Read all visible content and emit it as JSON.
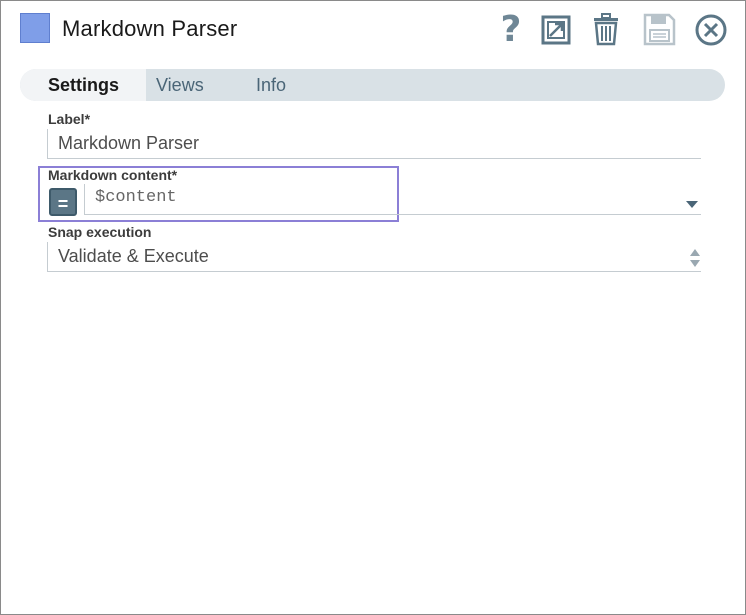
{
  "header": {
    "title": "Markdown Parser",
    "swatch_color": "#7f9ee8",
    "icons": [
      "help-icon",
      "export-icon",
      "delete-icon",
      "save-icon",
      "close-icon"
    ]
  },
  "tabs": [
    {
      "label": "Settings",
      "active": true
    },
    {
      "label": "Views",
      "active": false
    },
    {
      "label": "Info",
      "active": false
    }
  ],
  "form": {
    "label": {
      "label": "Label*",
      "value": "Markdown Parser"
    },
    "markdown_content": {
      "label": "Markdown content*",
      "value": "$content",
      "expression_toggle": "="
    },
    "snap_execution": {
      "label": "Snap execution",
      "value": "Validate & Execute"
    }
  },
  "colors": {
    "accent_focus": "#8b7fd6",
    "tab_bar": "#d9e1e6",
    "icon": "#5b7686"
  }
}
